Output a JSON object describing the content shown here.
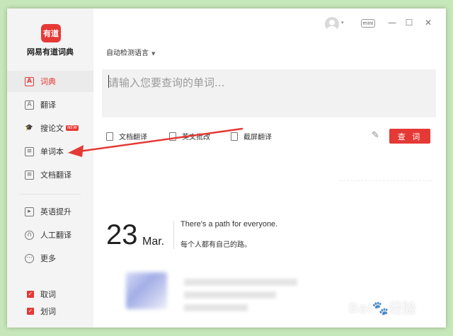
{
  "app": {
    "logo_text": "有道",
    "name": "网易有道词典"
  },
  "sidebar": {
    "items": [
      {
        "label": "词典",
        "icon": "dictionary-icon",
        "glyph": "A"
      },
      {
        "label": "翻译",
        "icon": "translate-icon",
        "glyph": "A"
      },
      {
        "label": "搜论文",
        "icon": "graduation-cap-icon",
        "glyph": "🎓",
        "badge": "NEW"
      },
      {
        "label": "单词本",
        "icon": "wordbook-icon",
        "glyph": "≡"
      },
      {
        "label": "文档翻译",
        "icon": "document-icon",
        "glyph": "≡"
      },
      {
        "label": "英语提升",
        "icon": "video-icon",
        "glyph": "▸"
      },
      {
        "label": "人工翻译",
        "icon": "headset-icon",
        "glyph": "∩"
      },
      {
        "label": "更多",
        "icon": "more-icon",
        "glyph": "···"
      }
    ],
    "checks": [
      {
        "label": "取词",
        "checked": true
      },
      {
        "label": "划词",
        "checked": true
      }
    ]
  },
  "topbar": {
    "mini_label": "mini",
    "minimize_glyph": "—",
    "maximize_glyph": "☐",
    "close_glyph": "✕"
  },
  "search": {
    "language_label": "自动检测语言",
    "placeholder": "请输入您要查询的单词..."
  },
  "tools": {
    "doc_translate": "文档翻译",
    "essay_check": "英文批改",
    "screenshot_translate": "截屏翻译",
    "query_button": "查 词"
  },
  "daily": {
    "day": "23",
    "month": "Mar.",
    "quote_en": "There's a path for everyone.",
    "quote_zh": "每个人都有自己的路。"
  },
  "watermark": {
    "text": "Bai🐾经验",
    "url": "jingyan.baidu.com"
  },
  "colors": {
    "accent": "#e53935",
    "background": "#c6e7b9",
    "sidebar": "#f4f4f4"
  }
}
